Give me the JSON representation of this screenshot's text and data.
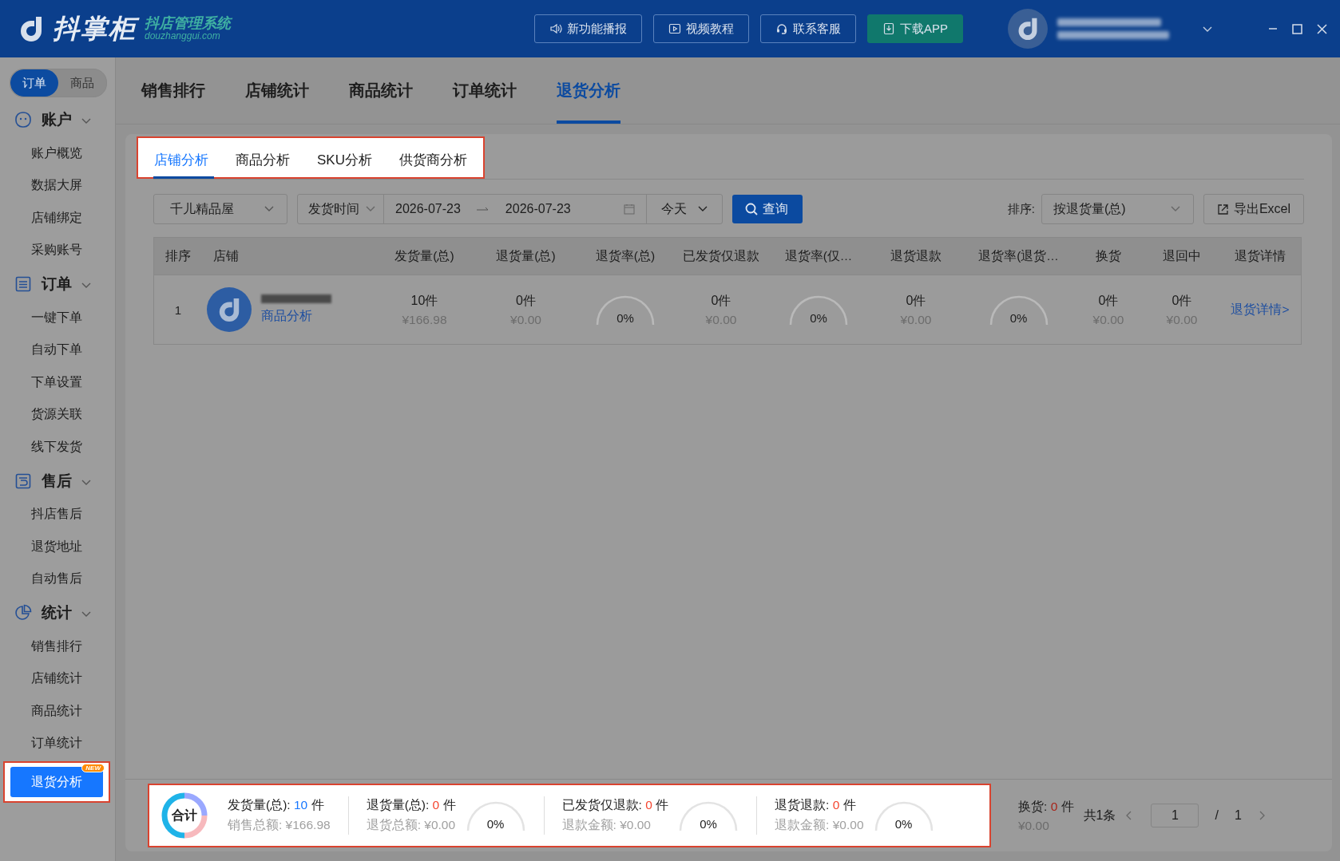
{
  "header": {
    "logo": {
      "name": "抖掌柜",
      "tagline": "抖店管理系统",
      "domain": "douzhanggui.com"
    },
    "buttons": [
      {
        "label": "新功能播报",
        "kind": "speaker"
      },
      {
        "label": "视频教程",
        "kind": "video"
      },
      {
        "label": "联系客服",
        "kind": "headset"
      },
      {
        "label": "下载APP",
        "kind": "download"
      }
    ]
  },
  "sidebar": {
    "toggle": [
      {
        "label": "订单",
        "selected": true
      },
      {
        "label": "商品",
        "selected": false
      }
    ],
    "groups": [
      {
        "title": "账户",
        "expanded": true,
        "items": [
          {
            "label": "账户概览",
            "selected": false
          },
          {
            "label": "数据大屏",
            "selected": false
          },
          {
            "label": "店铺绑定",
            "selected": false
          },
          {
            "label": "采购账号",
            "selected": false
          }
        ]
      },
      {
        "title": "订单",
        "expanded": true,
        "items": [
          {
            "label": "一键下单",
            "selected": false
          },
          {
            "label": "自动下单",
            "selected": false
          },
          {
            "label": "下单设置",
            "selected": false
          },
          {
            "label": "货源关联",
            "selected": false
          },
          {
            "label": "线下发货",
            "selected": false
          }
        ]
      },
      {
        "title": "售后",
        "expanded": true,
        "items": [
          {
            "label": "抖店售后",
            "selected": false
          },
          {
            "label": "退货地址",
            "selected": false
          },
          {
            "label": "自动售后",
            "selected": false
          }
        ]
      },
      {
        "title": "统计",
        "expanded": true,
        "items": [
          {
            "label": "销售排行",
            "selected": false
          },
          {
            "label": "店铺统计",
            "selected": false
          },
          {
            "label": "商品统计",
            "selected": false
          },
          {
            "label": "订单统计",
            "selected": false
          },
          {
            "label": "退货分析",
            "selected": true,
            "badge": "NEW"
          }
        ]
      }
    ]
  },
  "top_tabs": [
    {
      "label": "销售排行",
      "selected": false
    },
    {
      "label": "店铺统计",
      "selected": false
    },
    {
      "label": "商品统计",
      "selected": false
    },
    {
      "label": "订单统计",
      "selected": false
    },
    {
      "label": "退货分析",
      "selected": true
    }
  ],
  "sub_tabs": [
    {
      "label": "店铺分析",
      "selected": true
    },
    {
      "label": "商品分析",
      "selected": false
    },
    {
      "label": "SKU分析",
      "selected": false
    },
    {
      "label": "供货商分析",
      "selected": false
    }
  ],
  "filters": {
    "shop": "千儿精品屋",
    "date_type": "发货时间",
    "start_date": "2026-07-23",
    "end_date": "2026-07-23",
    "range": "今天",
    "query_button": "查询",
    "sort_label": "排序:",
    "sort_value": "按退货量(总)",
    "export_button": "导出Excel"
  },
  "table": {
    "columns": [
      "排序",
      "店铺",
      "发货量(总)",
      "退货量(总)",
      "退货率(总)",
      "已发货仅退款",
      "退货率(仅…",
      "退货退款",
      "退货率(退货…",
      "换货",
      "退回中",
      "退货详情"
    ],
    "rows": [
      {
        "cells": [
          {
            "kind": "rank",
            "text": "1"
          },
          {
            "kind": "shop",
            "link": "商品分析"
          },
          {
            "kind": "amount",
            "count": "10件",
            "amount": "¥166.98"
          },
          {
            "kind": "amount",
            "count": "0件",
            "amount": "¥0.00"
          },
          {
            "kind": "gauge",
            "value": "0%"
          },
          {
            "kind": "amount",
            "count": "0件",
            "amount": "¥0.00"
          },
          {
            "kind": "gauge",
            "value": "0%"
          },
          {
            "kind": "amount",
            "count": "0件",
            "amount": "¥0.00"
          },
          {
            "kind": "gauge",
            "value": "0%"
          },
          {
            "kind": "amount",
            "count": "0件",
            "amount": "¥0.00"
          },
          {
            "kind": "amount",
            "count": "0件",
            "amount": "¥0.00"
          },
          {
            "kind": "link",
            "link": "退货详情>"
          }
        ]
      }
    ]
  },
  "summary": {
    "title": "合计",
    "stats": [
      {
        "label": "发货量(总):",
        "value": "10",
        "unit": "件",
        "sub": "销售总额: ¥166.98",
        "color": "#1677ff"
      },
      {
        "label": "退货量(总):",
        "value": "0",
        "unit": "件",
        "sub": "退货总额: ¥0.00",
        "color": "#f5452f",
        "gauge": "0%"
      },
      {
        "label": "已发货仅退款:",
        "value": "0",
        "unit": "件",
        "sub": "退款金额: ¥0.00",
        "color": "#f5452f",
        "gauge": "0%"
      },
      {
        "label": "退货退款:",
        "value": "0",
        "unit": "件",
        "sub": "退款金额: ¥0.00",
        "color": "#f5452f",
        "gauge": "0%"
      }
    ],
    "exchange": {
      "label": "换货:",
      "value": "0",
      "unit": "件",
      "sub": "¥0.00",
      "color": "#a8241a"
    }
  },
  "pagination": {
    "total": "共1条",
    "page": "1",
    "separator": "/",
    "pages": "1"
  }
}
